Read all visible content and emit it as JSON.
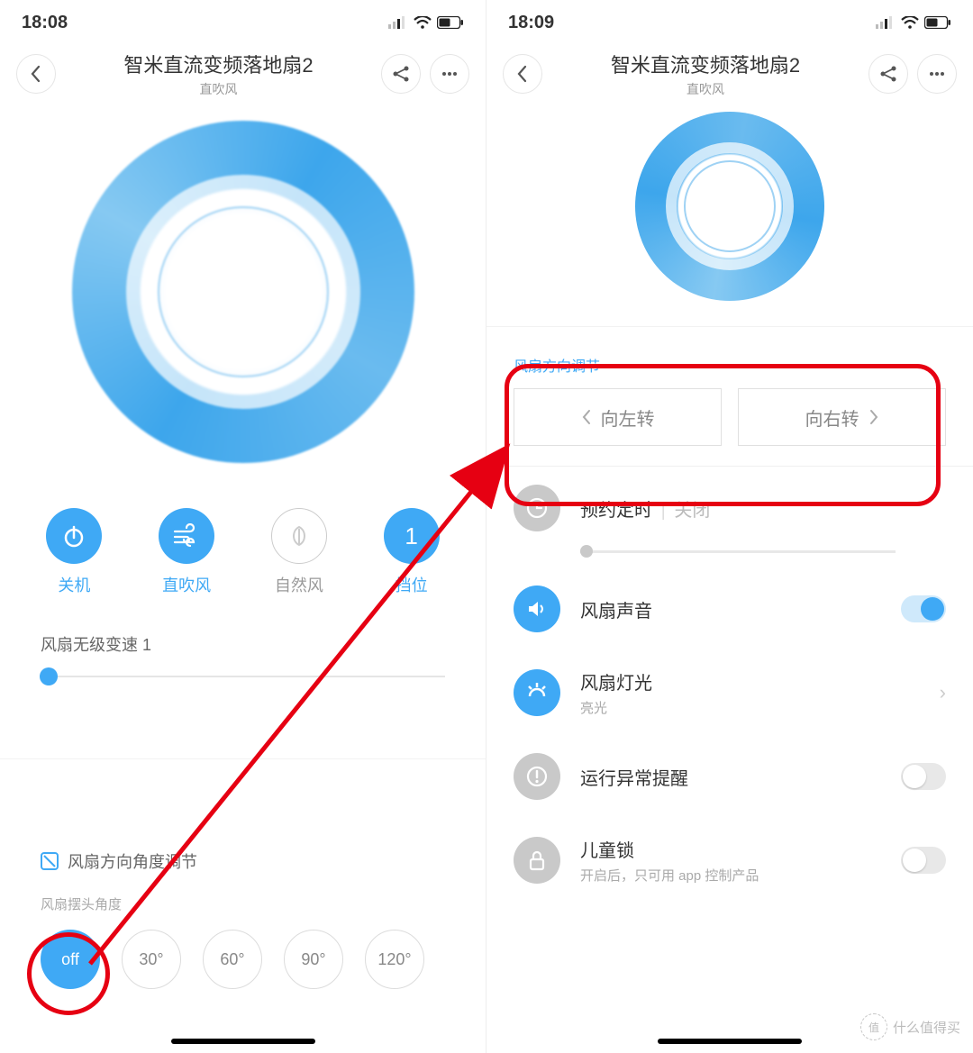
{
  "left": {
    "time": "18:08",
    "title": "智米直流变频落地扇2",
    "subtitle": "直吹风",
    "modes": [
      {
        "label": "关机",
        "icon": "power",
        "active": true
      },
      {
        "label": "直吹风",
        "icon": "wind",
        "active": true
      },
      {
        "label": "自然风",
        "icon": "leaf",
        "active": false
      },
      {
        "label": "挡位",
        "icon": "1",
        "active": true
      }
    ],
    "slider_label": "风扇无级变速 1",
    "angle_title": "风扇方向角度调节",
    "angle_sub": "风扇摆头角度",
    "angles": [
      "off",
      "30°",
      "60°",
      "90°",
      "120°"
    ]
  },
  "right": {
    "time": "18:09",
    "title": "智米直流变频落地扇2",
    "subtitle": "直吹风",
    "direction_section_label": "风扇方向调节",
    "turn_left_label": "向左转",
    "turn_right_label": "向右转",
    "items": {
      "timer": {
        "title": "预约定时",
        "status": "关闭"
      },
      "sound": {
        "title": "风扇声音"
      },
      "light": {
        "title": "风扇灯光",
        "sub": "亮光"
      },
      "warn": {
        "title": "运行异常提醒"
      },
      "lock": {
        "title": "儿童锁",
        "sub": "开启后，只可用 app 控制产品"
      }
    }
  },
  "watermark": "什么值得买",
  "colors": {
    "accent": "#3fa9f5",
    "annot": "#e60012"
  }
}
